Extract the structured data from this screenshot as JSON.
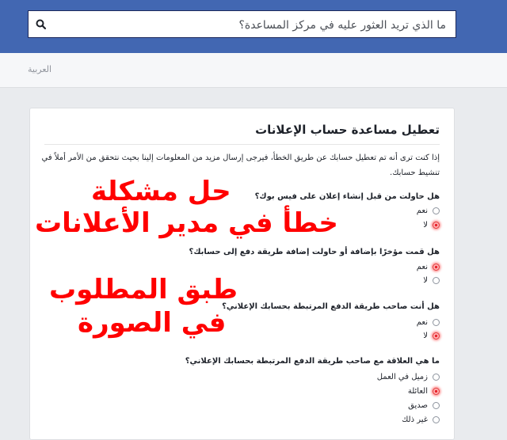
{
  "search": {
    "placeholder": "ما الذي تريد العثور عليه في مركز المساعدة؟",
    "icon": "search-icon"
  },
  "language": {
    "current": "العربية"
  },
  "form": {
    "title": "تعطيل مساعدة حساب الإعلانات",
    "intro": "إذا كنت ترى أنه تم تعطيل حسابك عن طريق الخطأ، فيرجى إرسال مزيد من المعلومات إلينا بحيث نتحقق من الأمر أملاً في تنشيط حسابك.",
    "questions": [
      {
        "text": "هل حاولت من قبل إنشاء إعلان على فيس بوك؟",
        "options": [
          "نعم",
          "لا"
        ],
        "selected": 1
      },
      {
        "text": "هل قمت مؤخرًا بإضافة أو حاولت إضافة طريقة دفع إلى حسابك؟",
        "options": [
          "نعم",
          "لا"
        ],
        "selected": 0
      },
      {
        "text": "هل أنت صاحب طريقة الدفع المرتبطة بحسابك الإعلاني؟",
        "options": [
          "نعم",
          "لا"
        ],
        "selected": 1
      },
      {
        "text": "ما هي العلاقة مع صاحب طريقة الدفع المرتبطة بحسابك الإعلاني؟",
        "options": [
          "زميل في العمل",
          "العائلة",
          "صديق",
          "غير ذلك"
        ],
        "selected": 1
      }
    ]
  },
  "overlay": {
    "line1": "حل مشكلة",
    "line2": "خطأ في مدير الأعلانات",
    "line3": "طبق المطلوب",
    "line4": "في الصورة",
    "color": "#ff0000"
  },
  "colors": {
    "topbar": "#4267b2",
    "selected_radio": "#e8202a"
  }
}
